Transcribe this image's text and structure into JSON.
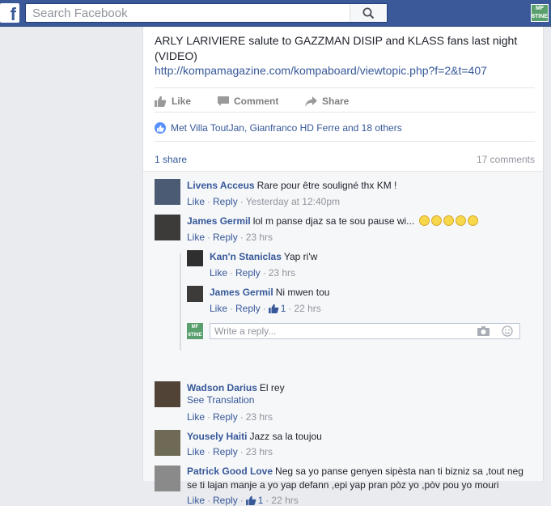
{
  "topbar": {
    "logo": "f",
    "search_placeholder": "Search Facebook",
    "brand_color": "#3b5998",
    "avatar_text": "MF 6TINE"
  },
  "post": {
    "text": "ARLY LARIVIERE salute to GAZZMAN DISIP and KLASS fans last night (VIDEO)",
    "link": "http://kompamagazine.com/kompaboard/viewtopic.php?f=2&t=407",
    "actions": {
      "like": "Like",
      "comment": "Comment",
      "share": "Share"
    },
    "likes_text": "Met Villa ToutJan, Gianfranco HD Ferre and 18 others",
    "shares": "1 share",
    "comments_count": "17 comments"
  },
  "comments": [
    {
      "name": "Livens Acceus",
      "text": "Rare pour être souligné thx KM !",
      "like": "Like",
      "reply": "Reply",
      "time": "Yesterday at 12:40pm"
    },
    {
      "name": "James Germil",
      "text": "lol m panse djaz sa te sou pause wi...",
      "like": "Like",
      "reply": "Reply",
      "time": "23 hrs",
      "emoji_count": 5
    },
    {
      "name": "Kan'n Staniclas",
      "text": "Yap ri'w",
      "like": "Like",
      "reply": "Reply",
      "time": "23 hrs"
    },
    {
      "name": "James Germil",
      "text": "Ni mwen tou",
      "like": "Like",
      "reply": "Reply",
      "likes": "1",
      "time": "22 hrs"
    },
    {
      "name": "Wadson Darius",
      "text": "El rey",
      "see_translation": "See Translation",
      "like": "Like",
      "reply": "Reply",
      "time": "23 hrs"
    },
    {
      "name": "Yousely Haiti",
      "text": "Jazz sa la toujou",
      "like": "Like",
      "reply": "Reply",
      "time": "23 hrs"
    },
    {
      "name": "Patrick Good Love",
      "text": "Neg sa yo panse genyen sipèsta nan ti bizniz sa ,tout neg",
      "text2": "se ti lajan manje a yo yap defann ,epi yap pran pòz yo ,pòv pou yo mouri",
      "like": "Like",
      "reply": "Reply",
      "likes": "1",
      "time": "22 hrs"
    }
  ],
  "reply_box": {
    "placeholder": "Write a reply...",
    "avatar_text": "MF 6TINE"
  },
  "separator": "·"
}
